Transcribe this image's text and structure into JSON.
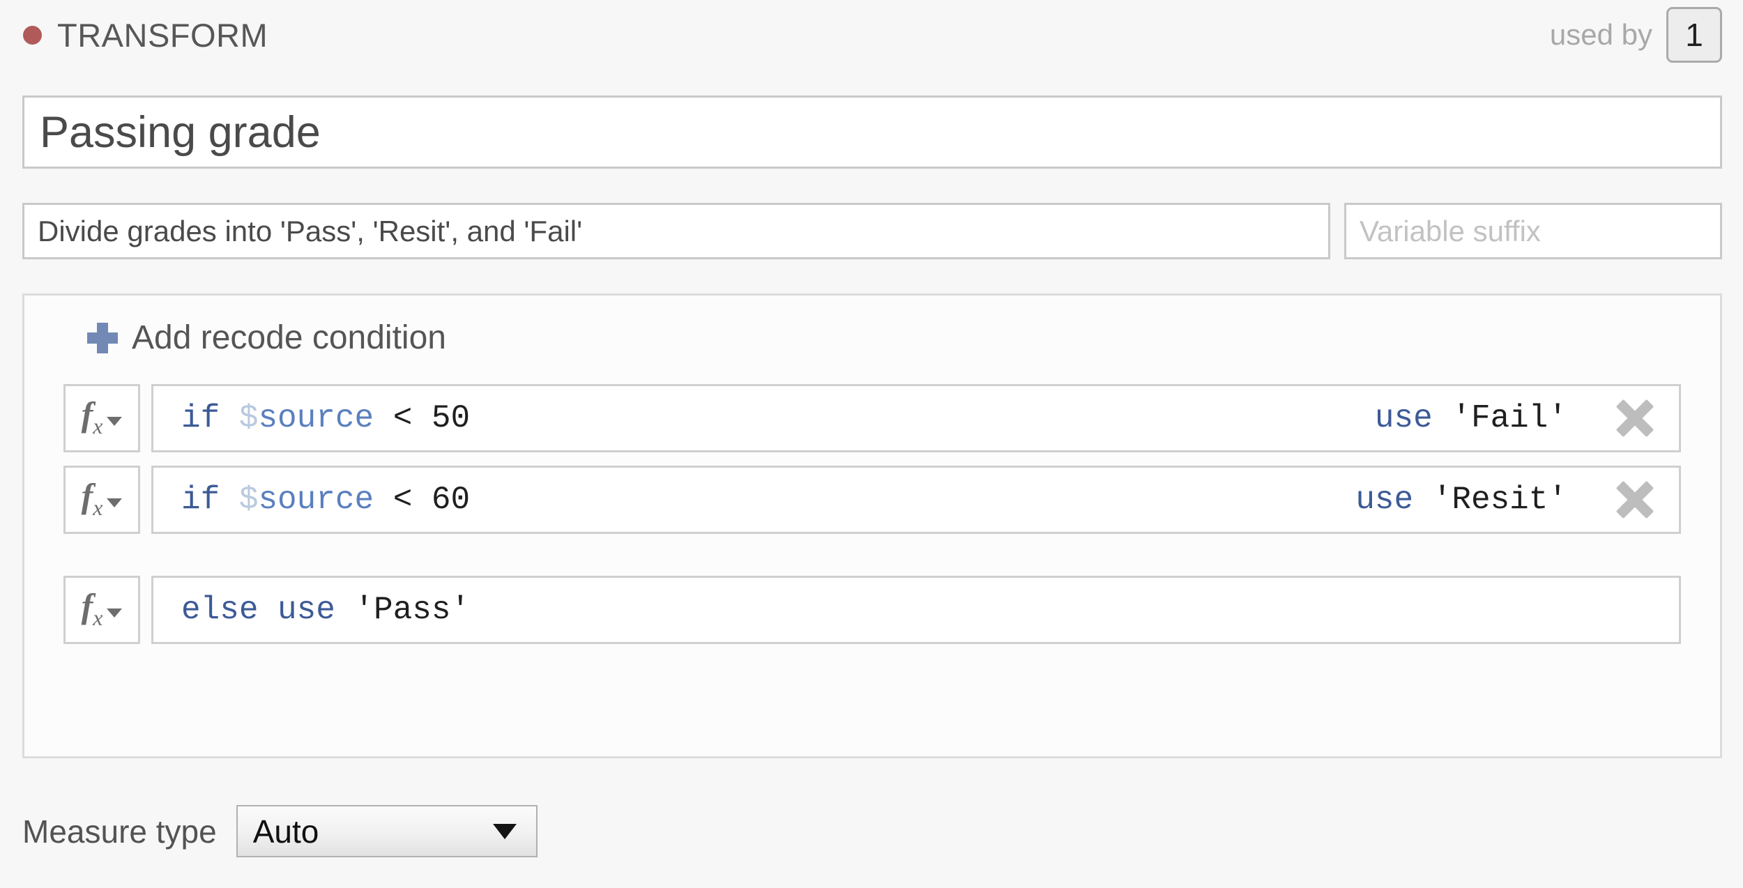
{
  "header": {
    "status_dot_color": "#b15a5a",
    "status_dot_name": "transform-status-dot",
    "title": "TRANSFORM",
    "used_by_label": "used by",
    "used_by_count": "1"
  },
  "name_field": {
    "value": "Passing grade"
  },
  "description_field": {
    "value": "Divide grades into 'Pass', 'Resit', and 'Fail'"
  },
  "suffix_field": {
    "value": "",
    "placeholder": "Variable suffix"
  },
  "recode": {
    "add_condition_label": "Add recode condition",
    "add_condition_icon": "plus-icon",
    "formula_icon": "fx-icon",
    "remove_icon": "close-x-icon",
    "conditions": [
      {
        "if_keyword": "if",
        "source_sigil": "$",
        "source_name": "source",
        "operator": "< 50",
        "use_keyword": "use",
        "use_value": "'Fail'",
        "removable": true
      },
      {
        "if_keyword": "if",
        "source_sigil": "$",
        "source_name": "source",
        "operator": "< 60",
        "use_keyword": "use",
        "use_value": "'Resit'",
        "removable": true
      }
    ],
    "else_condition": {
      "else_keyword": "else use",
      "use_value": "'Pass'",
      "removable": false
    }
  },
  "measure_type": {
    "label": "Measure type",
    "selected": "Auto",
    "caret_icon": "chevron-down-icon"
  }
}
